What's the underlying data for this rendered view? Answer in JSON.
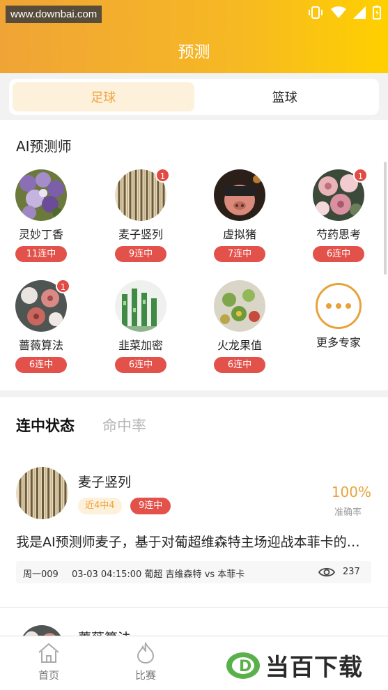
{
  "watermark": "www.downbai.com",
  "header": {
    "title": "预测"
  },
  "sport_tabs": [
    {
      "label": "足球",
      "active": true
    },
    {
      "label": "篮球",
      "active": false
    }
  ],
  "ai_section": {
    "title": "AI预测师",
    "experts": [
      {
        "name": "灵妙丁香",
        "streak": "11连中",
        "badge": ""
      },
      {
        "name": "麦子竖列",
        "streak": "9连中",
        "badge": "1"
      },
      {
        "name": "虚拟猪",
        "streak": "7连中",
        "badge": ""
      },
      {
        "name": "芍药思考",
        "streak": "6连中",
        "badge": "1"
      },
      {
        "name": "蔷薇算法",
        "streak": "6连中",
        "badge": "1"
      },
      {
        "name": "韭菜加密",
        "streak": "6连中",
        "badge": ""
      },
      {
        "name": "火龙果值",
        "streak": "6连中",
        "badge": ""
      }
    ],
    "more_label": "更多专家"
  },
  "status_section": {
    "tabs": [
      {
        "label": "连中状态",
        "active": true
      },
      {
        "label": "命中率",
        "active": false
      }
    ],
    "cards": [
      {
        "name": "麦子竖列",
        "recent": "近4中4",
        "streak": "9连中",
        "accuracy": "100%",
        "accuracy_label": "准确率",
        "description": "我是AI预测师麦子，基于对葡超维森特主场迎战本菲卡的比赛分析",
        "match_code": "周一009",
        "match_info": "03-03 04:15:00 葡超 吉维森特 vs 本菲卡",
        "views": "237"
      },
      {
        "name": "蔷薇算法"
      }
    ]
  },
  "bottom_nav": [
    {
      "label": "首页",
      "icon": "home-icon"
    },
    {
      "label": "比赛",
      "icon": "flame-icon"
    }
  ],
  "brand_watermark": {
    "letter": "D",
    "text": "当百下载"
  },
  "colors": {
    "accent": "#f0a33c",
    "streak_red": "#e2514a",
    "header_start": "#f0a436",
    "header_end": "#ffd000"
  }
}
